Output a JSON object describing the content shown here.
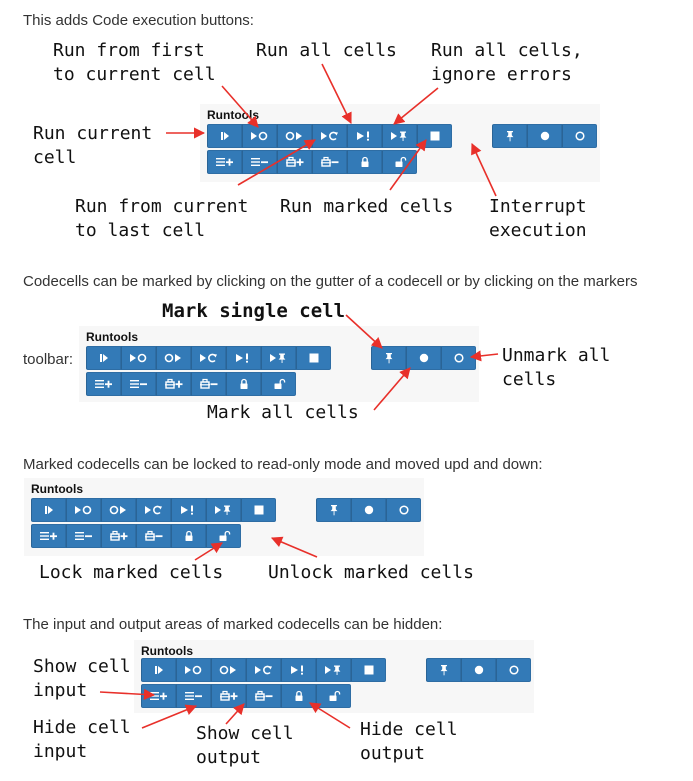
{
  "paragraphs": {
    "p1": "This adds Code execution buttons:",
    "p2": "Codecells can be marked by clicking on the gutter of a codecell or by clicking on the markers",
    "p3": "Marked codecells can be locked to read-only mode and moved upd and down:",
    "p4": "The input and output areas of marked codecells can be hidden:"
  },
  "toolbar": {
    "title": "Runtools",
    "run_buttons": [
      "run-current-icon",
      "run-from-first-icon",
      "run-from-current-icon",
      "run-all-icon",
      "run-all-ignore-errors-icon",
      "run-marked-icon",
      "interrupt-icon"
    ],
    "mark_buttons": [
      "mark-single-icon",
      "mark-all-icon",
      "unmark-all-icon"
    ],
    "io_buttons": [
      "show-input-icon",
      "hide-input-icon",
      "show-output-icon",
      "hide-output-icon",
      "lock-icon",
      "unlock-icon"
    ],
    "color": "#337ab7"
  },
  "notes": {
    "run_from_first_l1": "Run from first",
    "run_from_first_l2": "to current cell",
    "run_all": "Run all cells",
    "run_all_ignore_l1": "Run all cells,",
    "run_all_ignore_l2": "ignore errors",
    "run_current_l1": "Run current",
    "run_current_l2": "cell",
    "run_from_current_l1": "Run from current",
    "run_from_current_l2": "to last cell",
    "run_marked": "Run marked cells",
    "interrupt_l1": "Interrupt",
    "interrupt_l2": "execution",
    "mark_single": "Mark single cell",
    "toolbar_label": "toolbar:",
    "unmark_all_l1": "Unmark all",
    "unmark_all_l2": "cells",
    "mark_all": "Mark all cells",
    "lock_marked": "Lock marked cells",
    "unlock_marked": "Unlock marked cells",
    "show_input_l1": "Show cell",
    "show_input_l2": "input",
    "hide_input_l1": "Hide cell",
    "hide_input_l2": "input",
    "show_output_l1": "Show cell",
    "show_output_l2": "output",
    "hide_output_l1": "Hide cell",
    "hide_output_l2": "output"
  },
  "arrow_color": "#e8302a"
}
